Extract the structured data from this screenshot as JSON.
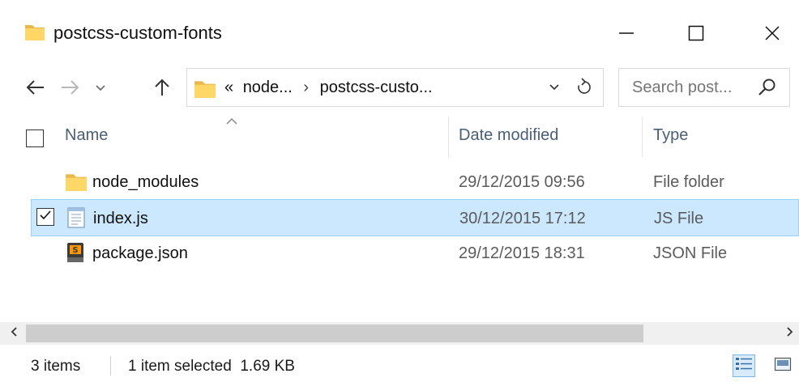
{
  "window": {
    "title": "postcss-custom-fonts"
  },
  "address": {
    "overflow": "«",
    "segments": [
      "node...",
      "postcss-custo..."
    ]
  },
  "search": {
    "placeholder": "Search post..."
  },
  "columns": {
    "name": "Name",
    "date": "Date modified",
    "type": "Type"
  },
  "files": [
    {
      "name": "node_modules",
      "date": "29/12/2015 09:56",
      "type": "File folder",
      "icon": "folder-icon",
      "selected": false
    },
    {
      "name": "index.js",
      "date": "30/12/2015 17:12",
      "type": "JS File",
      "icon": "js-file-icon",
      "selected": true
    },
    {
      "name": "package.json",
      "date": "29/12/2015 18:31",
      "type": "JSON File",
      "icon": "sublime-file-icon",
      "selected": false
    }
  ],
  "status": {
    "item_count": "3 items",
    "selection": "1 item selected  1.69 KB"
  },
  "colors": {
    "selection_bg": "#cce8ff",
    "selection_border": "#99d1ff",
    "folder_yellow": "#ffd766",
    "header_text": "#4a5e78"
  }
}
